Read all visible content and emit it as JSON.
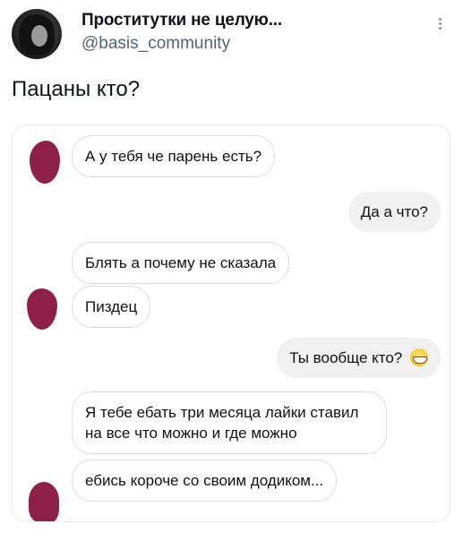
{
  "tweet": {
    "display_name": "Проститутки не целую...",
    "handle": "@basis_community",
    "text": "Пацаны кто?"
  },
  "chat": {
    "messages": [
      {
        "side": "incoming",
        "text": "А у тебя че парень есть?"
      },
      {
        "side": "outgoing",
        "text": "Да а что?"
      },
      {
        "side": "incoming",
        "text": "Блять а почему не сказала"
      },
      {
        "side": "incoming",
        "text": "Пиздец"
      },
      {
        "side": "outgoing",
        "text": "Ты вообще кто?",
        "emoji": "grinning-face-icon"
      },
      {
        "side": "incoming",
        "text": "Я тебе ебать три месяца лайки ставил на все что можно и где можно"
      },
      {
        "side": "incoming",
        "text": "ебись короче со своим додиком..."
      }
    ]
  },
  "colors": {
    "avatar_blob": "#8e2048",
    "incoming_bubble_border": "#dcdcdc",
    "outgoing_bubble_bg": "#f0f0f0",
    "handle_gray": "#536471"
  }
}
